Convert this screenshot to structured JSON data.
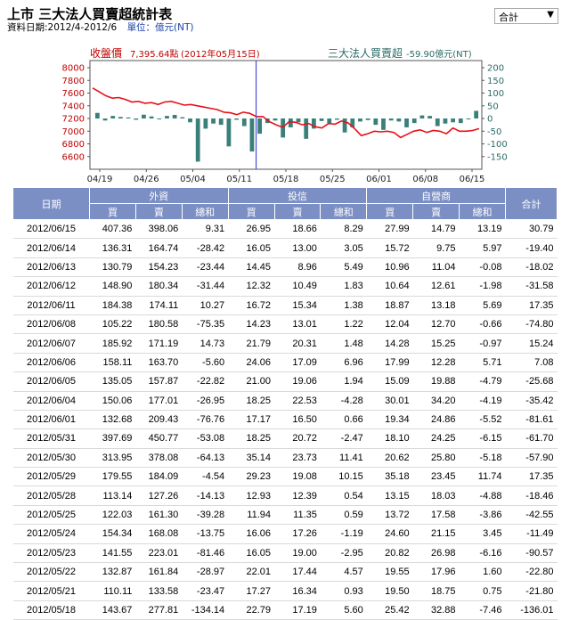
{
  "header": {
    "title": "上市 三大法人買賣超統計表",
    "date_range": "資料日期:2012/4-2012/6",
    "unit": "單位：億元(NT)",
    "select_value": "合計",
    "select_arrow": "▼"
  },
  "colors": {
    "price_line": "#e8101a",
    "bars": "#3a7f7a",
    "header_bg": "#7c8fc4",
    "marker": "#4b4bd6",
    "left_axis": "#c00000",
    "right_axis": "#2b6b66"
  },
  "chart_data": {
    "type": "bar+line",
    "left_title": "收盤價",
    "left_value": "7,395.64點",
    "left_date": "(2012年05月15日)",
    "right_title": "三大法人買賣超",
    "right_value": "-59.90億元(NT)",
    "left_axis": {
      "min": 6400,
      "max": 8000,
      "ticks": [
        "8000",
        "7800",
        "7600",
        "7400",
        "7200",
        "7000",
        "6800",
        "6600"
      ]
    },
    "right_axis": {
      "min": -200,
      "max": 200,
      "ticks": [
        "200",
        "150",
        "100",
        "50",
        "0",
        "-50",
        "-100",
        "-150"
      ]
    },
    "x_labels": [
      "04/19",
      "04/26",
      "05/04",
      "05/11",
      "05/18",
      "05/25",
      "06/01",
      "06/08",
      "06/15"
    ],
    "bar_values": [
      22,
      -8,
      10,
      6,
      4,
      -5,
      15,
      8,
      -3,
      10,
      14,
      5,
      -15,
      -170,
      -40,
      -20,
      -25,
      -110,
      -5,
      -30,
      -130,
      -60,
      -18,
      -8,
      -75,
      -35,
      -15,
      -80,
      -40,
      -10,
      -18,
      -5,
      -55,
      -35,
      -12,
      -6,
      -25,
      -45,
      -8,
      -12,
      -35,
      -18,
      12,
      10,
      -30,
      -20,
      -15,
      -18,
      -3,
      30
    ],
    "price_values": [
      7680,
      7620,
      7560,
      7520,
      7530,
      7500,
      7460,
      7470,
      7440,
      7450,
      7420,
      7460,
      7470,
      7440,
      7410,
      7420,
      7400,
      7380,
      7360,
      7340,
      7300,
      7290,
      7260,
      7300,
      7280,
      7230,
      7230,
      7150,
      7100,
      7060,
      7150,
      7140,
      7100,
      7120,
      7070,
      7050,
      7120,
      7110,
      7160,
      7130,
      7040,
      6930,
      6960,
      7000,
      6990,
      7000,
      6980,
      6900,
      6950,
      7000,
      7020,
      6980,
      7010,
      7000,
      6960,
      7050,
      7000,
      7000,
      7010,
      7040
    ],
    "marker_date": "05/15"
  },
  "table": {
    "h_date": "日期",
    "h_foreign": "外資",
    "h_trust": "投信",
    "h_dealer": "自營商",
    "h_total": "合計",
    "h_buy": "買",
    "h_sell": "賣",
    "h_net": "總和",
    "rows": [
      [
        "2012/06/15",
        "407.36",
        "398.06",
        "9.31",
        "26.95",
        "18.66",
        "8.29",
        "27.99",
        "14.79",
        "13.19",
        "30.79"
      ],
      [
        "2012/06/14",
        "136.31",
        "164.74",
        "-28.42",
        "16.05",
        "13.00",
        "3.05",
        "15.72",
        "9.75",
        "5.97",
        "-19.40"
      ],
      [
        "2012/06/13",
        "130.79",
        "154.23",
        "-23.44",
        "14.45",
        "8.96",
        "5.49",
        "10.96",
        "11.04",
        "-0.08",
        "-18.02"
      ],
      [
        "2012/06/12",
        "148.90",
        "180.34",
        "-31.44",
        "12.32",
        "10.49",
        "1.83",
        "10.64",
        "12.61",
        "-1.98",
        "-31.58"
      ],
      [
        "2012/06/11",
        "184.38",
        "174.11",
        "10.27",
        "16.72",
        "15.34",
        "1.38",
        "18.87",
        "13.18",
        "5.69",
        "17.35"
      ],
      [
        "2012/06/08",
        "105.22",
        "180.58",
        "-75.35",
        "14.23",
        "13.01",
        "1.22",
        "12.04",
        "12.70",
        "-0.66",
        "-74.80"
      ],
      [
        "2012/06/07",
        "185.92",
        "171.19",
        "14.73",
        "21.79",
        "20.31",
        "1.48",
        "14.28",
        "15.25",
        "-0.97",
        "15.24"
      ],
      [
        "2012/06/06",
        "158.11",
        "163.70",
        "-5.60",
        "24.06",
        "17.09",
        "6.96",
        "17.99",
        "12.28",
        "5.71",
        "7.08"
      ],
      [
        "2012/06/05",
        "135.05",
        "157.87",
        "-22.82",
        "21.00",
        "19.06",
        "1.94",
        "15.09",
        "19.88",
        "-4.79",
        "-25.68"
      ],
      [
        "2012/06/04",
        "150.06",
        "177.01",
        "-26.95",
        "18.25",
        "22.53",
        "-4.28",
        "30.01",
        "34.20",
        "-4.19",
        "-35.42"
      ],
      [
        "2012/06/01",
        "132.68",
        "209.43",
        "-76.76",
        "17.17",
        "16.50",
        "0.66",
        "19.34",
        "24.86",
        "-5.52",
        "-81.61"
      ],
      [
        "2012/05/31",
        "397.69",
        "450.77",
        "-53.08",
        "18.25",
        "20.72",
        "-2.47",
        "18.10",
        "24.25",
        "-6.15",
        "-61.70"
      ],
      [
        "2012/05/30",
        "313.95",
        "378.08",
        "-64.13",
        "35.14",
        "23.73",
        "11.41",
        "20.62",
        "25.80",
        "-5.18",
        "-57.90"
      ],
      [
        "2012/05/29",
        "179.55",
        "184.09",
        "-4.54",
        "29.23",
        "19.08",
        "10.15",
        "35.18",
        "23.45",
        "11.74",
        "17.35"
      ],
      [
        "2012/05/28",
        "113.14",
        "127.26",
        "-14.13",
        "12.93",
        "12.39",
        "0.54",
        "13.15",
        "18.03",
        "-4.88",
        "-18.46"
      ],
      [
        "2012/05/25",
        "122.03",
        "161.30",
        "-39.28",
        "11.94",
        "11.35",
        "0.59",
        "13.72",
        "17.58",
        "-3.86",
        "-42.55"
      ],
      [
        "2012/05/24",
        "154.34",
        "168.08",
        "-13.75",
        "16.06",
        "17.26",
        "-1.19",
        "24.60",
        "21.15",
        "3.45",
        "-11.49"
      ],
      [
        "2012/05/23",
        "141.55",
        "223.01",
        "-81.46",
        "16.05",
        "19.00",
        "-2.95",
        "20.82",
        "26.98",
        "-6.16",
        "-90.57"
      ],
      [
        "2012/05/22",
        "132.87",
        "161.84",
        "-28.97",
        "22.01",
        "17.44",
        "4.57",
        "19.55",
        "17.96",
        "1.60",
        "-22.80"
      ],
      [
        "2012/05/21",
        "110.11",
        "133.58",
        "-23.47",
        "17.27",
        "16.34",
        "0.93",
        "19.50",
        "18.75",
        "0.75",
        "-21.80"
      ],
      [
        "2012/05/18",
        "143.67",
        "277.81",
        "-134.14",
        "22.79",
        "17.19",
        "5.60",
        "25.42",
        "32.88",
        "-7.46",
        "-136.01"
      ]
    ]
  }
}
